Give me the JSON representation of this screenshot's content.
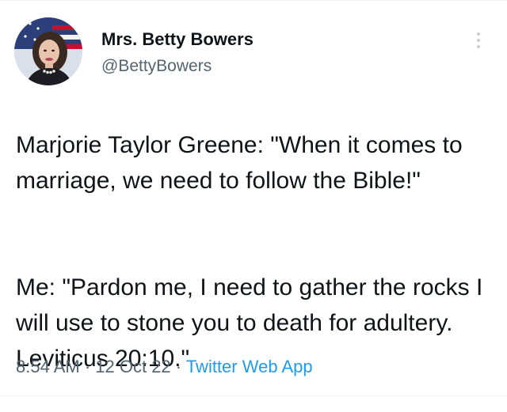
{
  "author": {
    "display_name": "Mrs. Betty Bowers",
    "handle": "@BettyBowers"
  },
  "tweet": {
    "paragraphs": [
      "Marjorie Taylor Greene: \"When it comes to marriage, we need to follow the Bible!\"",
      "Me: \"Pardon me, I need to gather the rocks I will use to stone you to death for adultery. Leviticus 20:10.\""
    ],
    "time": "8:54 AM",
    "separator": " · ",
    "date": "12 Oct 22",
    "source": "Twitter Web App"
  },
  "icons": {
    "more": "more-vertical-icon"
  },
  "colors": {
    "text": "#0f1419",
    "secondary_text": "#536471",
    "link": "#1d9bf0",
    "more_dots": "#c4cdd3"
  }
}
